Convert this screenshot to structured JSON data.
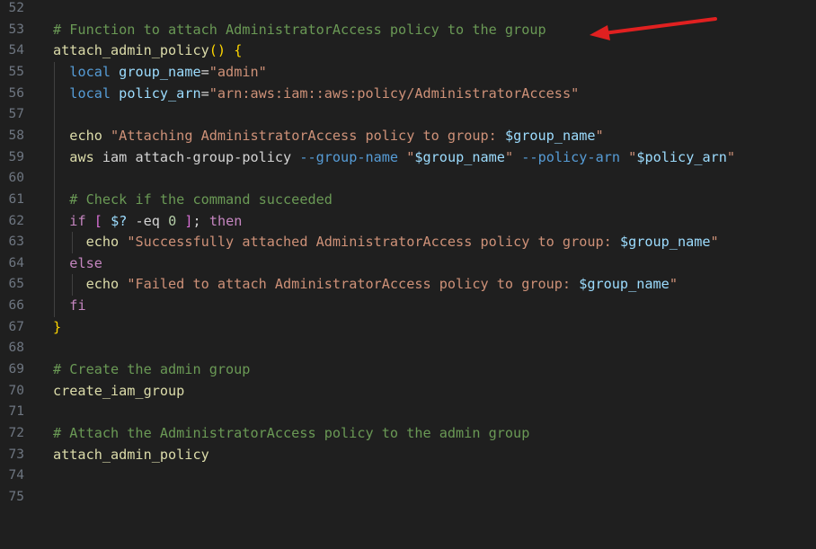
{
  "editor": {
    "lines": [
      {
        "n": "52",
        "tokens": []
      },
      {
        "n": "53",
        "tokens": [
          {
            "c": "c-comment",
            "t": "# Function to attach AdministratorAccess policy to the group"
          }
        ]
      },
      {
        "n": "54",
        "tokens": [
          {
            "c": "c-fn",
            "t": "attach_admin_policy"
          },
          {
            "c": "c-brace",
            "t": "()"
          },
          {
            "c": "c-text",
            "t": " "
          },
          {
            "c": "c-brace",
            "t": "{"
          }
        ]
      },
      {
        "n": "55",
        "tokens": [
          {
            "c": "c-text",
            "t": "  "
          },
          {
            "c": "c-kw",
            "t": "local"
          },
          {
            "c": "c-text",
            "t": " "
          },
          {
            "c": "c-var",
            "t": "group_name"
          },
          {
            "c": "c-text",
            "t": "="
          },
          {
            "c": "c-str",
            "t": "\"admin\""
          }
        ]
      },
      {
        "n": "56",
        "tokens": [
          {
            "c": "c-text",
            "t": "  "
          },
          {
            "c": "c-kw",
            "t": "local"
          },
          {
            "c": "c-text",
            "t": " "
          },
          {
            "c": "c-var",
            "t": "policy_arn"
          },
          {
            "c": "c-text",
            "t": "="
          },
          {
            "c": "c-str",
            "t": "\"arn:aws:iam::aws:policy/AdministratorAccess\""
          }
        ]
      },
      {
        "n": "57",
        "tokens": []
      },
      {
        "n": "58",
        "tokens": [
          {
            "c": "c-text",
            "t": "  "
          },
          {
            "c": "c-cmd",
            "t": "echo"
          },
          {
            "c": "c-text",
            "t": " "
          },
          {
            "c": "c-str",
            "t": "\"Attaching AdministratorAccess policy to group: "
          },
          {
            "c": "c-var",
            "t": "$group_name"
          },
          {
            "c": "c-str",
            "t": "\""
          }
        ]
      },
      {
        "n": "59",
        "tokens": [
          {
            "c": "c-text",
            "t": "  "
          },
          {
            "c": "c-cmd",
            "t": "aws"
          },
          {
            "c": "c-text",
            "t": " iam attach-group-policy "
          },
          {
            "c": "c-kw",
            "t": "--group-name"
          },
          {
            "c": "c-text",
            "t": " "
          },
          {
            "c": "c-str",
            "t": "\""
          },
          {
            "c": "c-var",
            "t": "$group_name"
          },
          {
            "c": "c-str",
            "t": "\""
          },
          {
            "c": "c-text",
            "t": " "
          },
          {
            "c": "c-kw",
            "t": "--policy-arn"
          },
          {
            "c": "c-text",
            "t": " "
          },
          {
            "c": "c-str",
            "t": "\""
          },
          {
            "c": "c-var",
            "t": "$policy_arn"
          },
          {
            "c": "c-str",
            "t": "\""
          }
        ]
      },
      {
        "n": "60",
        "tokens": []
      },
      {
        "n": "61",
        "tokens": [
          {
            "c": "c-text",
            "t": "  "
          },
          {
            "c": "c-comment",
            "t": "# Check if the command succeeded"
          }
        ]
      },
      {
        "n": "62",
        "tokens": [
          {
            "c": "c-text",
            "t": "  "
          },
          {
            "c": "c-ctrl",
            "t": "if"
          },
          {
            "c": "c-text",
            "t": " "
          },
          {
            "c": "c-brace2",
            "t": "["
          },
          {
            "c": "c-text",
            "t": " "
          },
          {
            "c": "c-var",
            "t": "$?"
          },
          {
            "c": "c-text",
            "t": " -eq "
          },
          {
            "c": "c-num",
            "t": "0"
          },
          {
            "c": "c-text",
            "t": " "
          },
          {
            "c": "c-brace2",
            "t": "]"
          },
          {
            "c": "c-text",
            "t": "; "
          },
          {
            "c": "c-ctrl",
            "t": "then"
          }
        ]
      },
      {
        "n": "63",
        "tokens": [
          {
            "c": "c-text",
            "t": "    "
          },
          {
            "c": "c-cmd",
            "t": "echo"
          },
          {
            "c": "c-text",
            "t": " "
          },
          {
            "c": "c-str",
            "t": "\"Successfully attached AdministratorAccess policy to group: "
          },
          {
            "c": "c-var",
            "t": "$group_name"
          },
          {
            "c": "c-str",
            "t": "\""
          }
        ]
      },
      {
        "n": "64",
        "tokens": [
          {
            "c": "c-text",
            "t": "  "
          },
          {
            "c": "c-ctrl",
            "t": "else"
          }
        ]
      },
      {
        "n": "65",
        "tokens": [
          {
            "c": "c-text",
            "t": "    "
          },
          {
            "c": "c-cmd",
            "t": "echo"
          },
          {
            "c": "c-text",
            "t": " "
          },
          {
            "c": "c-str",
            "t": "\"Failed to attach AdministratorAccess policy to group: "
          },
          {
            "c": "c-var",
            "t": "$group_name"
          },
          {
            "c": "c-str",
            "t": "\""
          }
        ]
      },
      {
        "n": "66",
        "tokens": [
          {
            "c": "c-text",
            "t": "  "
          },
          {
            "c": "c-ctrl",
            "t": "fi"
          }
        ]
      },
      {
        "n": "67",
        "tokens": [
          {
            "c": "c-brace",
            "t": "}"
          }
        ]
      },
      {
        "n": "68",
        "tokens": []
      },
      {
        "n": "69",
        "tokens": [
          {
            "c": "c-comment",
            "t": "# Create the admin group"
          }
        ]
      },
      {
        "n": "70",
        "tokens": [
          {
            "c": "c-cmd",
            "t": "create_iam_group"
          }
        ]
      },
      {
        "n": "71",
        "tokens": []
      },
      {
        "n": "72",
        "tokens": [
          {
            "c": "c-comment",
            "t": "# Attach the AdministratorAccess policy to the admin group"
          }
        ]
      },
      {
        "n": "73",
        "tokens": [
          {
            "c": "c-cmd",
            "t": "attach_admin_policy"
          }
        ]
      },
      {
        "n": "74",
        "tokens": []
      },
      {
        "n": "75",
        "tokens": []
      }
    ]
  },
  "annotation": {
    "arrow_color": "#e02020",
    "icon": "red-arrow-icon"
  },
  "theme": {
    "background": "#1f1f1f",
    "line_number": "#6e7681"
  }
}
